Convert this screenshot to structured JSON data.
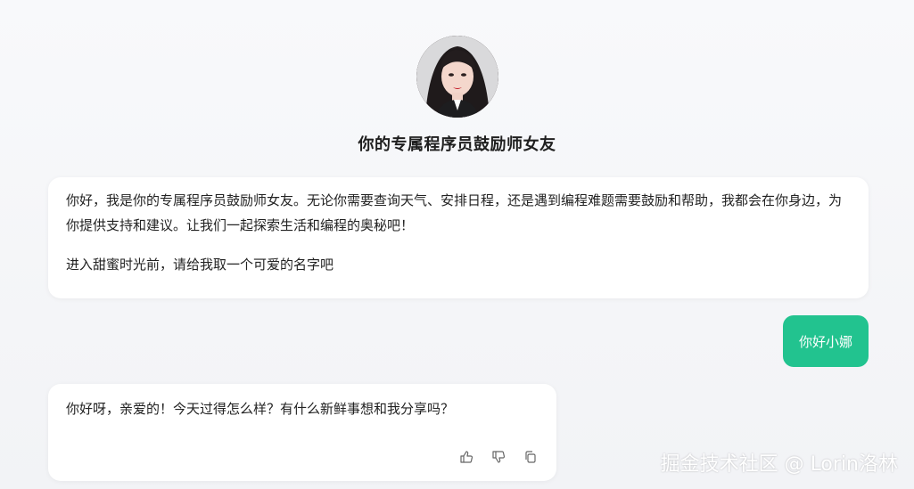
{
  "header": {
    "title": "你的专属程序员鼓励师女友"
  },
  "messages": {
    "bot_1": {
      "paragraph_1": "你好，我是你的专属程序员鼓励师女友。无论你需要查询天气、安排日程，还是遇到编程难题需要鼓励和帮助，我都会在你身边，为你提供支持和建议。让我们一起探索生活和编程的奥秘吧！",
      "paragraph_2": "进入甜蜜时光前，请给我取一个可爱的名字吧"
    },
    "user_1": {
      "text": "你好小娜"
    },
    "bot_2": {
      "text": "你好呀，亲爱的！今天过得怎么样？有什么新鲜事想和我分享吗？",
      "actions": [
        "thumbs-up-icon",
        "thumbs-down-icon",
        "copy-icon"
      ]
    }
  },
  "watermark": "掘金技术社区 @ Lorin洛林",
  "colors": {
    "accent": "#22c38f",
    "background": "#f3f4f7",
    "bubble": "#ffffff"
  }
}
